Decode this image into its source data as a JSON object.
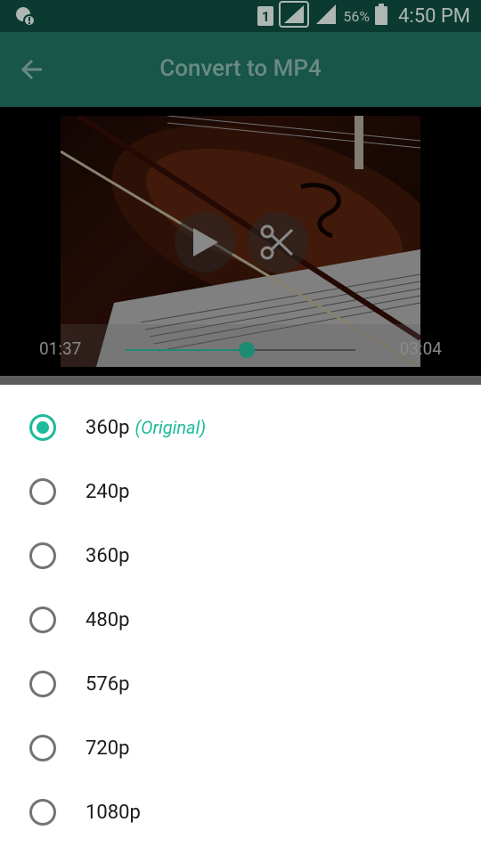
{
  "status_bar": {
    "sim": "1",
    "battery_percent": "56%",
    "time": "4:50 PM"
  },
  "toolbar": {
    "title": "Convert to MP4"
  },
  "player": {
    "current_time": "01:37",
    "total_time": "03:04",
    "progress": 0.527
  },
  "options": [
    {
      "label": "360p",
      "tag": "(Original)",
      "selected": true
    },
    {
      "label": "240p",
      "tag": "",
      "selected": false
    },
    {
      "label": "360p",
      "tag": "",
      "selected": false
    },
    {
      "label": "480p",
      "tag": "",
      "selected": false
    },
    {
      "label": "576p",
      "tag": "",
      "selected": false
    },
    {
      "label": "720p",
      "tag": "",
      "selected": false
    },
    {
      "label": "1080p",
      "tag": "",
      "selected": false
    }
  ],
  "colors": {
    "accent": "#1dbb99",
    "toolbar": "#175648",
    "status_bar": "#0b3a30"
  }
}
